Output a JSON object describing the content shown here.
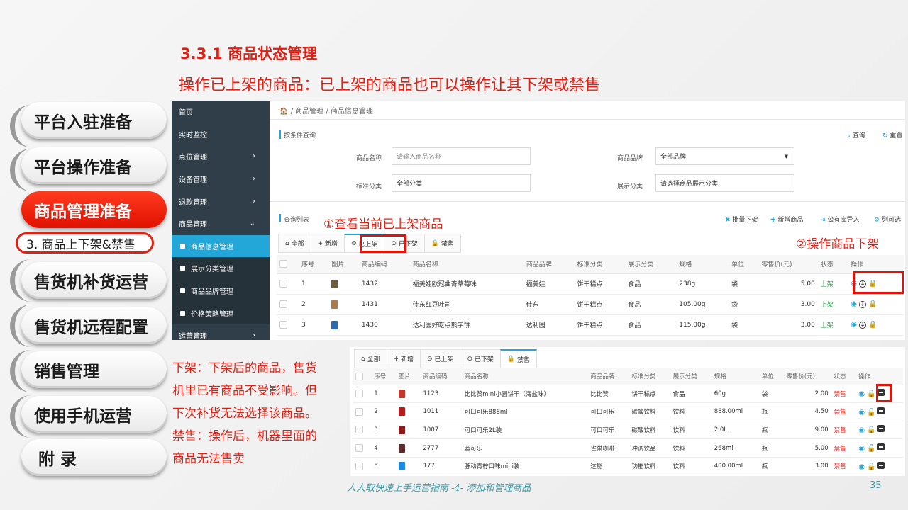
{
  "slide": {
    "heading": "3.3.1 商品状态管理",
    "subheading": "操作已上架的商品：已上架的商品也可以操作让其下架或禁售",
    "footer": "人人取快速上手运营指南 -4- 添加和管理商品",
    "page_number": "35"
  },
  "nav": {
    "items": [
      "平台入驻准备",
      "平台操作准备",
      "商品管理准备",
      "售货机补货运营",
      "售货机远程配置",
      "销售管理",
      "使用手机运营",
      "附 录"
    ],
    "active_index": 2,
    "sub_item": "3. 商品上下架&禁售"
  },
  "colors": {
    "accent_red": "#e21f12",
    "admin_blue": "#22a7d8",
    "sidebar_dark": "#2f3e48",
    "status_green": "#27a745"
  },
  "admin": {
    "sidebar": [
      {
        "label": "首页",
        "arrow": ""
      },
      {
        "label": "实时监控",
        "arrow": ""
      },
      {
        "label": "点位管理",
        "arrow": "›"
      },
      {
        "label": "设备管理",
        "arrow": "›"
      },
      {
        "label": "退款管理",
        "arrow": "›"
      },
      {
        "label": "商品管理",
        "arrow": "⌄"
      },
      {
        "label": "商品信息管理",
        "sub": true,
        "current": true
      },
      {
        "label": "展示分类管理",
        "sub": true
      },
      {
        "label": "商品品牌管理",
        "sub": true
      },
      {
        "label": "价格策略管理",
        "sub": true
      },
      {
        "label": "运营管理",
        "arrow": "›"
      }
    ],
    "breadcrumb": "🏠 / 商品管理 / 商品信息管理",
    "filter_title": "按条件查询",
    "query_btn": "查询",
    "reset_btn": "重置",
    "fields": {
      "name_label": "商品名称",
      "name_placeholder": "请输入商品名称",
      "brand_label": "商品品牌",
      "brand_value": "全部品牌",
      "std_label": "标准分类",
      "std_value": "全部分类",
      "disp_label": "展示分类",
      "disp_placeholder": "请选择商品展示分类"
    },
    "list_title": "查询列表",
    "actions": [
      "批量下架",
      "新增商品",
      "公有库导入",
      "列可选"
    ],
    "tabs": [
      "全部",
      "新增",
      "已上架",
      "已下架",
      "禁售"
    ],
    "columns": [
      "序号",
      "图片",
      "商品编码",
      "商品名称",
      "商品品牌",
      "标准分类",
      "展示分类",
      "规格",
      "单位",
      "零售价(元)",
      "状态",
      "操作"
    ],
    "rows": [
      {
        "no": "1",
        "code": "1432",
        "name": "福美娃欧冠曲奇草莓味",
        "brand": "福美娃",
        "std": "饼干糕点",
        "disp": "食品",
        "spec": "238g",
        "unit": "袋",
        "price": "5.00",
        "status": "上架"
      },
      {
        "no": "2",
        "code": "1431",
        "name": "佳东红豆吐司",
        "brand": "佳东",
        "std": "饼干糕点",
        "disp": "食品",
        "spec": "105.00g",
        "unit": "袋",
        "price": "3.00",
        "status": "上架"
      },
      {
        "no": "3",
        "code": "1430",
        "name": "达利园好吃点熊字饼",
        "brand": "达利园",
        "std": "饼干糕点",
        "disp": "食品",
        "spec": "115.00g",
        "unit": "袋",
        "price": "3.00",
        "status": "上架"
      }
    ]
  },
  "annotations": {
    "a1": "①查看当前已上架商品",
    "a2": "②操作商品下架",
    "body": [
      "下架：下架后的商品，售货",
      "机里已有商品不受影响。但",
      "下次补货无法选择该商品。",
      "禁售：操作后，机器里面的",
      "商品无法售卖"
    ]
  },
  "admin2": {
    "tabs": [
      "全部",
      "新增",
      "已上架",
      "已下架",
      "禁售"
    ],
    "rows": [
      {
        "no": "1",
        "code": "1123",
        "name": "比比赞mini小圆饼干（海盐味）",
        "brand": "比比赞",
        "std": "饼干糕点",
        "disp": "食品",
        "spec": "60g",
        "unit": "袋",
        "price": "2.00",
        "status": "禁售"
      },
      {
        "no": "2",
        "code": "1011",
        "name": "可口可乐888ml",
        "brand": "可口可乐",
        "std": "碳酸饮料",
        "disp": "饮料",
        "spec": "888.00ml",
        "unit": "瓶",
        "price": "4.50",
        "status": "禁售"
      },
      {
        "no": "3",
        "code": "1007",
        "name": "可口可乐2L装",
        "brand": "可口可乐",
        "std": "碳酸饮料",
        "disp": "饮料",
        "spec": "2.0L",
        "unit": "瓶",
        "price": "9.00",
        "status": "禁售"
      },
      {
        "no": "4",
        "code": "2777",
        "name": "蓝可乐",
        "brand": "雀巢咖啡",
        "std": "冲调饮品",
        "disp": "饮料",
        "spec": "268ml",
        "unit": "瓶",
        "price": "5.00",
        "status": "禁售"
      },
      {
        "no": "5",
        "code": "177",
        "name": "脉动青柠口味mini装",
        "brand": "达能",
        "std": "功能饮料",
        "disp": "饮料",
        "spec": "400.00ml",
        "unit": "瓶",
        "price": "3.00",
        "status": "禁售"
      }
    ]
  }
}
